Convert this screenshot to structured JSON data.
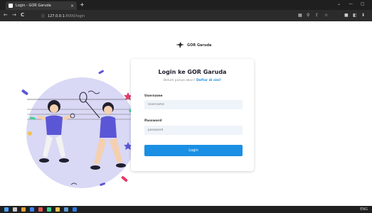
{
  "browser": {
    "tab_title": "Login - GOR Garuda",
    "tab_close": "×",
    "new_tab": "+",
    "window_controls": [
      "⌄",
      "—",
      "▢"
    ],
    "nav_icons": [
      "←",
      "→",
      "C"
    ],
    "url_host": "127.0.0.1",
    "url_path": ":8000/login",
    "extension_icons": [
      "▦",
      "⚲",
      "⇪",
      "☆",
      "■",
      "◧",
      "⬇"
    ]
  },
  "page": {
    "logo_name": "GOR Garuda",
    "login": {
      "title": "Login ke GOR Garuda",
      "subtitle_prefix": "Belum punya akun?",
      "register_link": "Daftar di sini!",
      "username_label": "Username",
      "username_placeholder": "Username",
      "password_label": "Password",
      "password_placeholder": "password",
      "button_label": "Login"
    }
  },
  "taskbar": {
    "tray_text": "ENG"
  },
  "colors": {
    "accent": "#1a8fe3",
    "illustration_bg": "#d9d8f5",
    "illustration_accent": "#5b56d6"
  }
}
